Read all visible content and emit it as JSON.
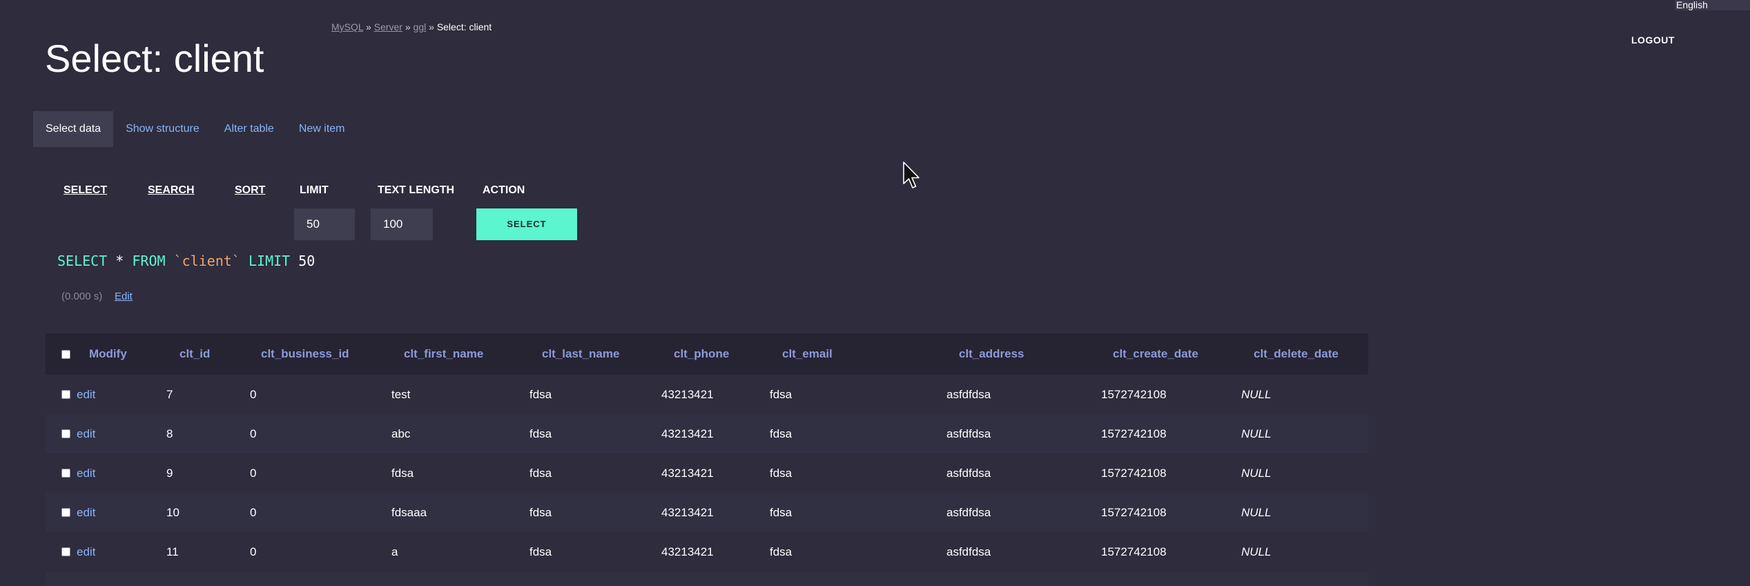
{
  "breadcrumb": {
    "items": [
      "MySQL",
      "Server",
      "ggl"
    ],
    "separator": "»",
    "current": "Select: client"
  },
  "language": "English",
  "logout_label": "LOGOUT",
  "page_title": "Select: client",
  "tabs": [
    {
      "label": "Select data",
      "active": true
    },
    {
      "label": "Show structure",
      "active": false
    },
    {
      "label": "Alter table",
      "active": false
    },
    {
      "label": "New item",
      "active": false
    }
  ],
  "query_form": {
    "select_label": "SELECT",
    "search_label": "SEARCH",
    "sort_label": "SORT",
    "limit_label": "LIMIT",
    "text_length_label": "TEXT LENGTH",
    "action_label": "ACTION",
    "limit_value": "50",
    "text_length_value": "100",
    "select_button": "SELECT"
  },
  "sql": {
    "kw_select": "SELECT",
    "star": "*",
    "kw_from": "FROM",
    "table": "`client`",
    "kw_limit": "LIMIT",
    "limit": "50"
  },
  "timing": "(0.000 s)",
  "edit_label": "Edit",
  "table": {
    "columns": [
      "Modify",
      "clt_id",
      "clt_business_id",
      "clt_first_name",
      "clt_last_name",
      "clt_phone",
      "clt_email",
      "clt_address",
      "clt_create_date",
      "clt_delete_date"
    ],
    "rows": [
      [
        "edit",
        "7",
        "0",
        "test",
        "fdsa",
        "43213421",
        "fdsa",
        "asfdfdsa",
        "1572742108",
        "NULL"
      ],
      [
        "edit",
        "8",
        "0",
        "abc",
        "fdsa",
        "43213421",
        "fdsa",
        "asfdfdsa",
        "1572742108",
        "NULL"
      ],
      [
        "edit",
        "9",
        "0",
        "fdsa",
        "fdsa",
        "43213421",
        "fdsa",
        "asfdfdsa",
        "1572742108",
        "NULL"
      ],
      [
        "edit",
        "10",
        "0",
        "fdsaaa",
        "fdsa",
        "43213421",
        "fdsa",
        "asfdfdsa",
        "1572742108",
        "NULL"
      ],
      [
        "edit",
        "11",
        "0",
        "a",
        "fdsa",
        "43213421",
        "fdsa",
        "asfdfdsa",
        "1572742108",
        "NULL"
      ]
    ]
  },
  "colors": {
    "background": "#2e2c3d",
    "accent": "#5bf5cf",
    "link": "#8ab4f8",
    "header_text": "#8b9bd8"
  },
  "cursor_icon": "mouse-pointer-icon"
}
